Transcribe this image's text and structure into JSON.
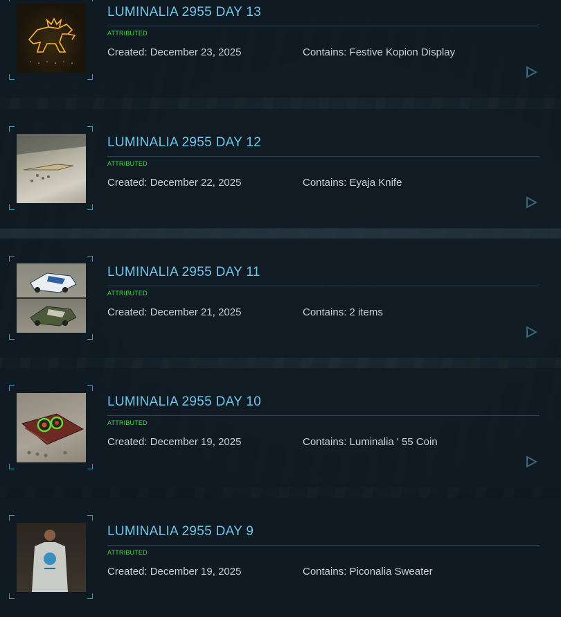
{
  "items": [
    {
      "title": "LUMINALIA 2955 DAY 13",
      "status": "ATTRIBUTED",
      "created": "Created: December 23, 2025",
      "contains": "Contains: Festive Kopion Display",
      "thumb": "neon-kopion"
    },
    {
      "title": "LUMINALIA 2955 DAY 12",
      "status": "ATTRIBUTED",
      "created": "Created: December 22, 2025",
      "contains": "Contains: Eyaja Knife",
      "thumb": "knife-snow"
    },
    {
      "title": "LUMINALIA 2955 DAY 11",
      "status": "ATTRIBUTED",
      "created": "Created: December 21, 2025",
      "contains": "Contains: 2 items",
      "thumb": "two-vehicles"
    },
    {
      "title": "LUMINALIA 2955 DAY 10",
      "status": "ATTRIBUTED",
      "created": "Created: December 19, 2025",
      "contains": "Contains: Luminalia ' 55 Coin",
      "thumb": "coin-blanket"
    },
    {
      "title": "LUMINALIA 2955 DAY 9",
      "status": "ATTRIBUTED",
      "created": "Created: December 19, 2025",
      "contains": "Contains: Piconalia Sweater",
      "thumb": "sweater"
    }
  ],
  "colors": {
    "title": "#6ec6ea",
    "status": "#3fdc3f",
    "accent": "#2ea0c0",
    "text": "#c7d1d6"
  },
  "icons": {
    "play": "play-triangle-icon"
  }
}
